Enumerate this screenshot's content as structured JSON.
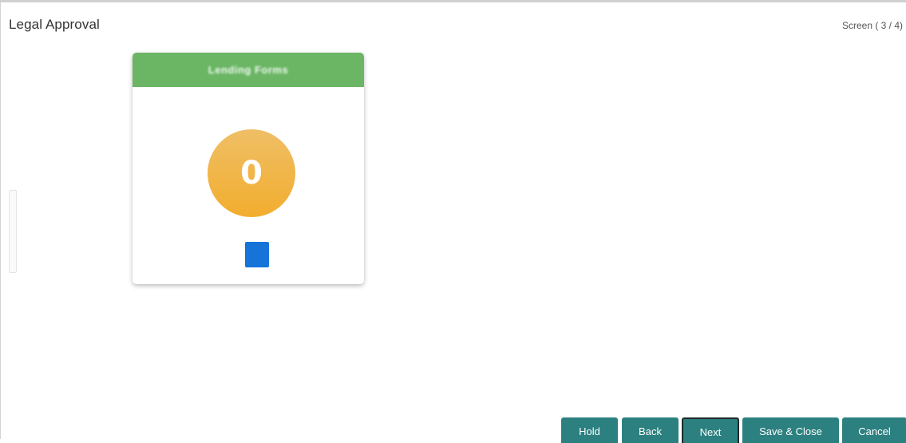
{
  "header": {
    "title": "Legal Approval",
    "screen_indicator": "Screen ( 3 / 4)"
  },
  "card": {
    "header_label": "Lending Forms",
    "count": "0",
    "header_color": "#6ab664",
    "circle_color": "#f2b33f",
    "action_color": "#1673d8"
  },
  "footer": {
    "hold_label": "Hold",
    "back_label": "Back",
    "next_label": "Next",
    "save_close_label": "Save & Close",
    "cancel_label": "Cancel",
    "button_color": "#2c8080"
  }
}
